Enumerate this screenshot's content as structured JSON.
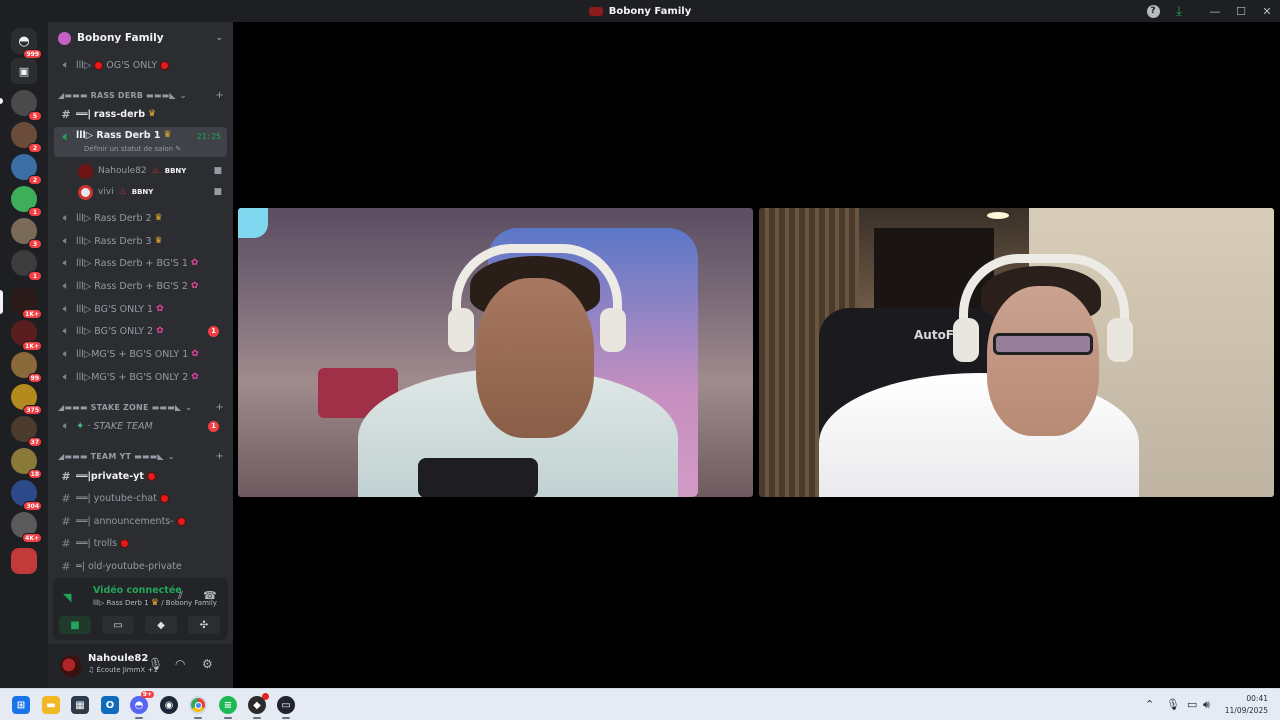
{
  "window": {
    "title": "Bobony Family"
  },
  "guild": {
    "name": "Bobony Family"
  },
  "rail": {
    "home_badge": "999",
    "servers": [
      {
        "badge": "5"
      },
      {
        "badge": "2"
      },
      {
        "badge": "2"
      },
      {
        "badge": "1"
      },
      {
        "badge": "3"
      },
      {
        "badge": "1"
      },
      {
        "badge": "1K+"
      },
      {
        "badge": "1K+"
      },
      {
        "badge": "99"
      },
      {
        "badge": "375"
      },
      {
        "badge": "37"
      },
      {
        "badge": "18"
      },
      {
        "badge": "304"
      },
      {
        "badge": "4K+"
      }
    ]
  },
  "channels": {
    "og_only": "lll▷ ",
    "og_only_label": "OG'S ONLY",
    "cat_rass": "◢▬▬▬ RASS DERB ▬▬▬◣",
    "rass_derb_text_prefix": "══|",
    "rass_derb_text": "rass-derb",
    "rass_derb_1": "lll▷ Rass Derb 1",
    "rass_derb_1_status": "Définir un statut de salon",
    "rass_derb_1_timer": "21:25",
    "voice_users": [
      {
        "name": "Nahoule82",
        "tag": "BBNY"
      },
      {
        "name": "vivi",
        "tag": "BBNY"
      }
    ],
    "rass_derb_2": "lll▷ Rass Derb 2",
    "rass_derb_3": "lll▷ Rass Derb 3",
    "rass_bg_1": "lll▷ Rass Derb + BG'S 1",
    "rass_bg_2": "lll▷ Rass Derb + BG'S 2",
    "bg_only_1": "lll▷ BG'S ONLY 1",
    "bg_only_2": "lll▷ BG'S ONLY 2",
    "bg_only_2_mentions": "1",
    "mg_bg_1": "lll▷MG'S + BG'S ONLY 1",
    "mg_bg_2": "lll▷MG'S + BG'S ONLY 2",
    "cat_stake": "◢▬▬▬ STAKE ZONE ▬▬▬◣",
    "stake_team": "· STAKE TEAM",
    "stake_team_mentions": "1",
    "cat_team": "◢▬▬▬ TEAM YT ▬▬▬◣",
    "private_yt": "══|private-yt",
    "youtube_chat": "══| youtube-chat",
    "announcements": "══| announcements-",
    "trolls": "══| trolls",
    "old_youtube": "═| old-youtube-private"
  },
  "voice_panel": {
    "title": "Vidéo connectée",
    "subtitle_channel": "lll▷ Rass Derb 1",
    "subtitle_guild": "/ Bobony Family"
  },
  "user_panel": {
    "name": "Nahoule82",
    "activity": "Écoute JimmX +1"
  },
  "stream": {
    "right_chair_text": "AutoF"
  },
  "taskbar": {
    "discord_badge": "9+",
    "time": "00:41",
    "date": "11/09/2025"
  },
  "colors": {
    "accent_green": "#23a55a",
    "mention_red": "#f23f43",
    "sidebar_bg": "#2b2d31",
    "rail_bg": "#1e1f22"
  }
}
